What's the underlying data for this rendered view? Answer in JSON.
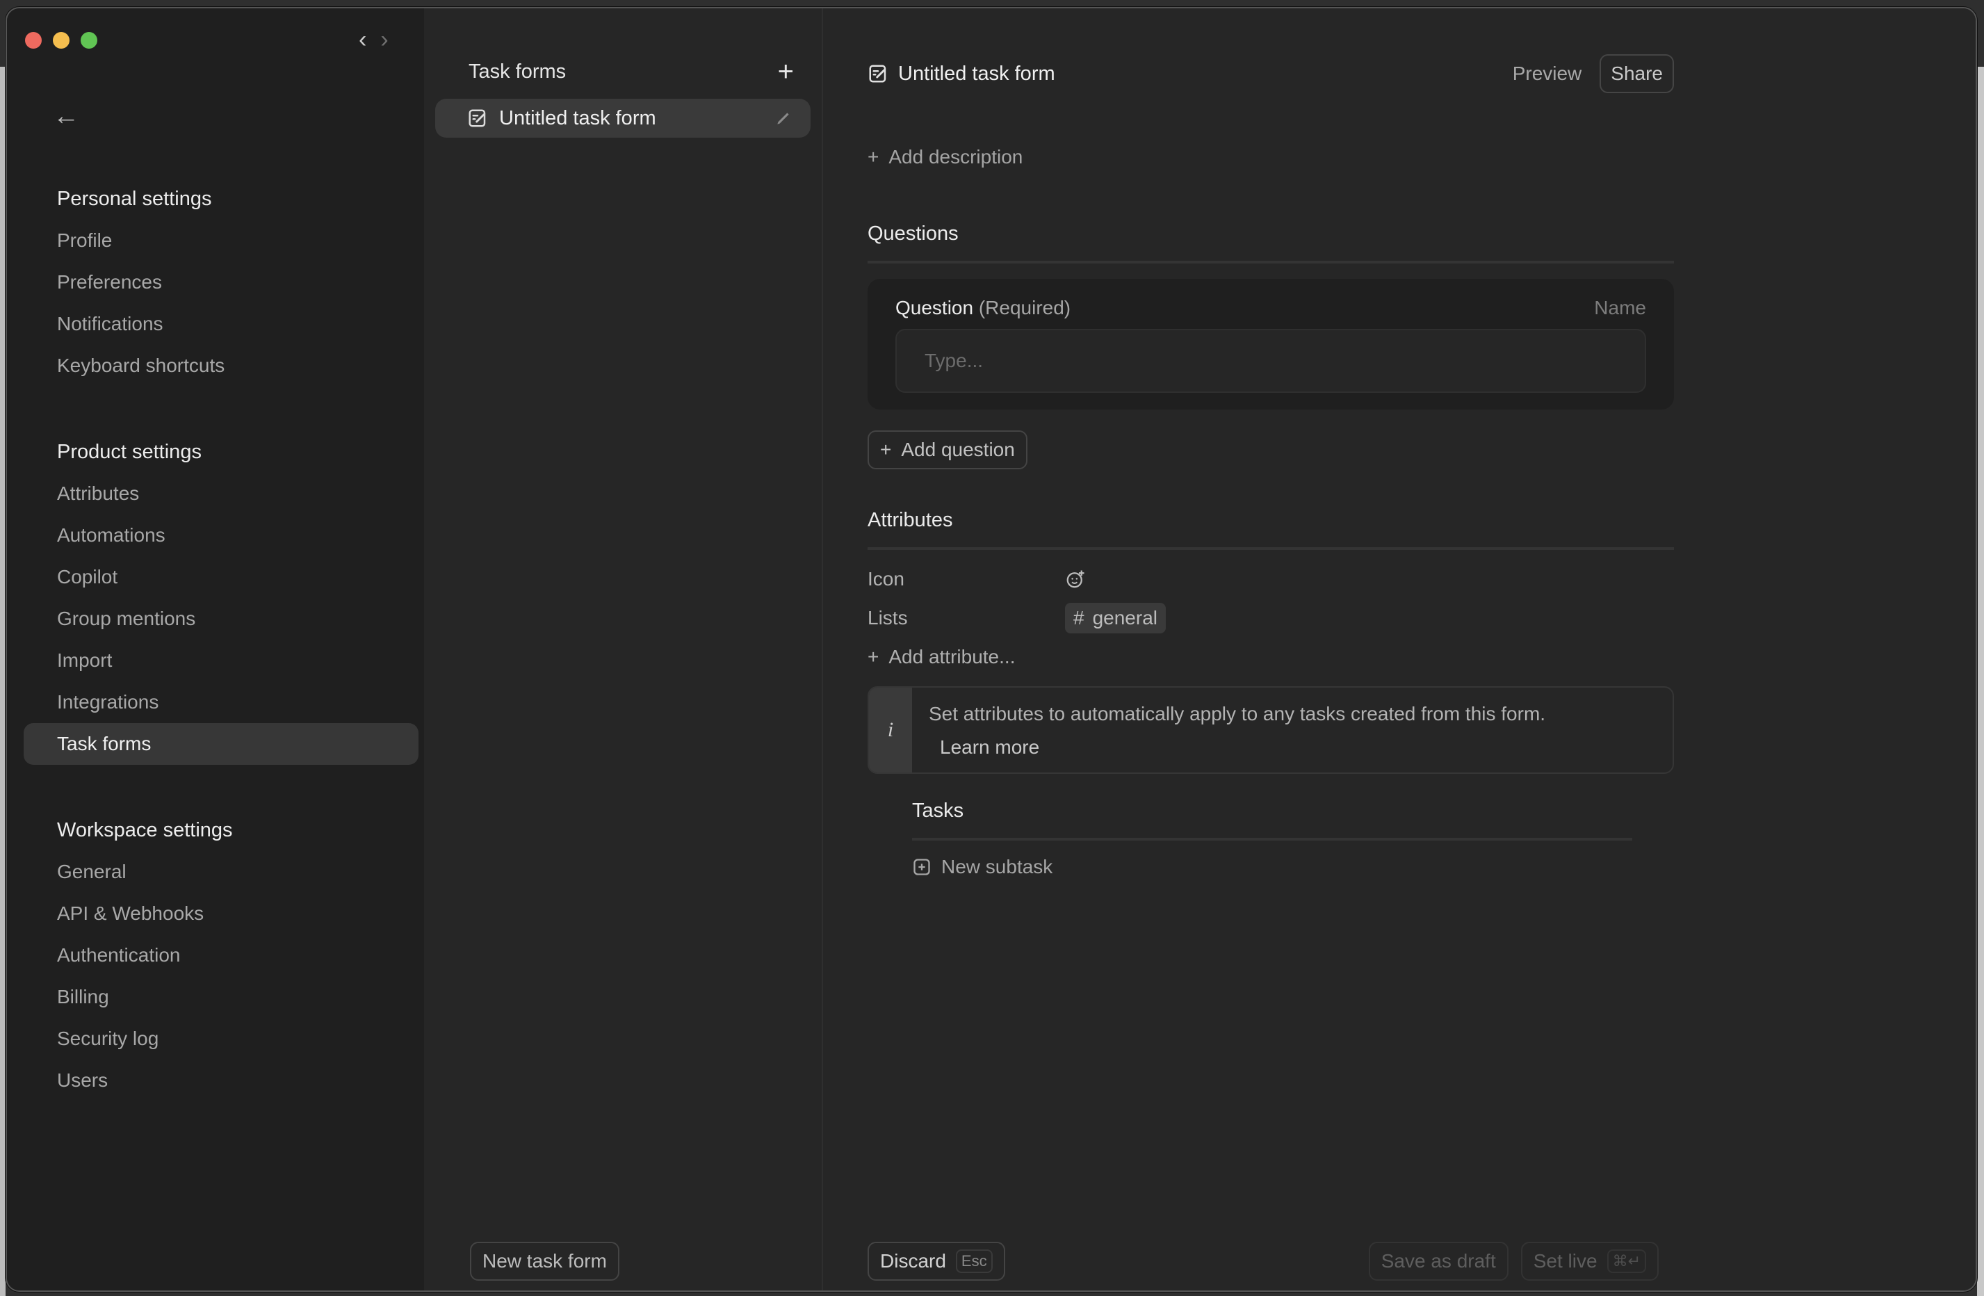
{
  "window": {
    "nav": {
      "back_glyph": "‹",
      "forward_glyph": "›"
    }
  },
  "sidebar": {
    "back_icon": "←",
    "sections": [
      {
        "heading": "Personal settings",
        "items": [
          {
            "label": "Profile"
          },
          {
            "label": "Preferences"
          },
          {
            "label": "Notifications"
          },
          {
            "label": "Keyboard shortcuts"
          }
        ]
      },
      {
        "heading": "Product settings",
        "items": [
          {
            "label": "Attributes"
          },
          {
            "label": "Automations"
          },
          {
            "label": "Copilot"
          },
          {
            "label": "Group mentions"
          },
          {
            "label": "Import"
          },
          {
            "label": "Integrations"
          },
          {
            "label": "Task forms",
            "active": true
          }
        ]
      },
      {
        "heading": "Workspace settings",
        "items": [
          {
            "label": "General"
          },
          {
            "label": "API & Webhooks"
          },
          {
            "label": "Authentication"
          },
          {
            "label": "Billing"
          },
          {
            "label": "Security log"
          },
          {
            "label": "Users"
          }
        ]
      }
    ]
  },
  "forms_list": {
    "title": "Task forms",
    "add_glyph": "+",
    "items": [
      {
        "label": "Untitled task form"
      }
    ],
    "new_button": "New task form"
  },
  "editor": {
    "title": "Untitled task form",
    "preview_label": "Preview",
    "share_label": "Share",
    "add_description": "Add description",
    "questions": {
      "heading": "Questions",
      "question_label": "Question",
      "required_label": "(Required)",
      "name_label": "Name",
      "input_placeholder": "Type...",
      "input_value": "",
      "add_question": "Add question"
    },
    "attributes": {
      "heading": "Attributes",
      "rows": [
        {
          "key": "Icon",
          "value_icon": "emoji-add-icon"
        },
        {
          "key": "Lists",
          "value_tag": "general"
        }
      ],
      "add_attribute": "Add attribute...",
      "info_glyph": "i",
      "info_text": "Set attributes to automatically apply to any tasks created from this form.",
      "learn_more": "Learn more"
    },
    "tasks": {
      "heading": "Tasks",
      "new_subtask": "New subtask"
    },
    "footer": {
      "discard_label": "Discard",
      "discard_shortcut": "Esc",
      "save_draft_label": "Save as draft",
      "set_live_label": "Set live",
      "set_live_shortcut": "⌘↵"
    }
  }
}
